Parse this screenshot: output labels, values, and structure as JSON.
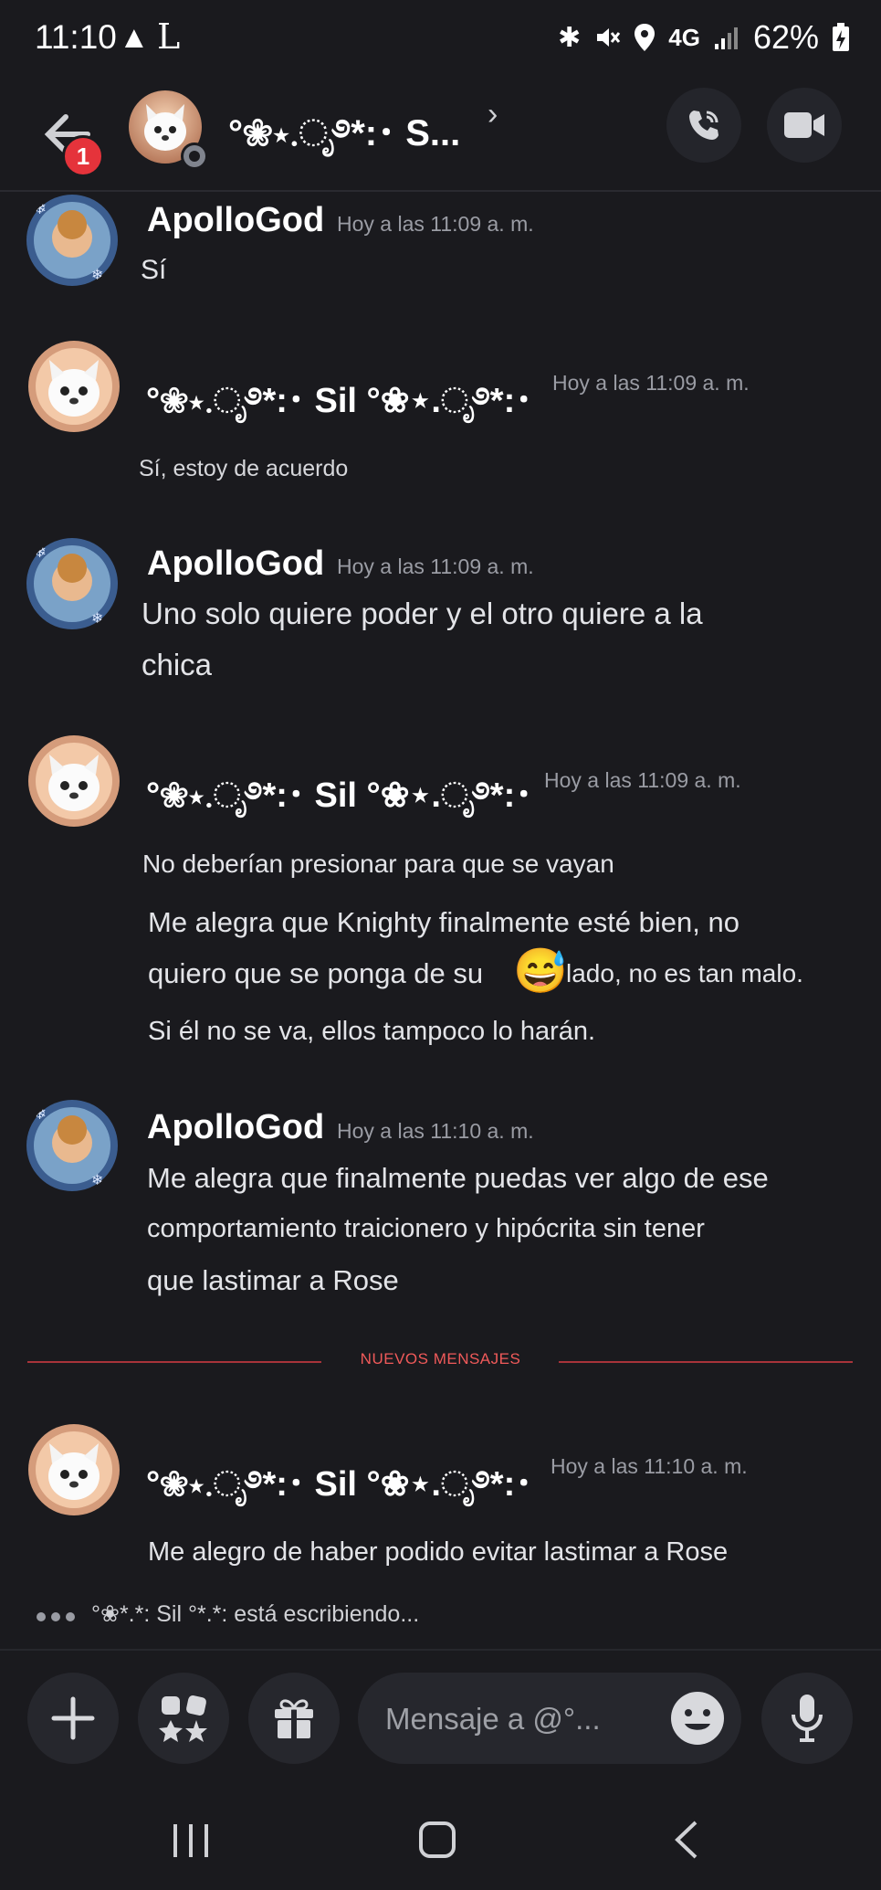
{
  "status_bar": {
    "time": "11:10",
    "network": "4G",
    "battery": "62%"
  },
  "header": {
    "title": "°❀⋆.ೃ࿔*:･ S...",
    "back_badge": "1",
    "chevron": "›"
  },
  "messages": [
    {
      "author": "ApolloGod",
      "time": "Hoy a las 11:09 a. m.",
      "lines": [
        "Sí"
      ]
    },
    {
      "author": "°❀⋆.ೃ࿔*:･ Sil °❀⋆.ೃ࿔*:･",
      "time": "Hoy a las 11:09 a. m.",
      "lines": [
        "Sí, estoy de acuerdo"
      ]
    },
    {
      "author": "ApolloGod",
      "time": "Hoy a las 11:09 a. m.",
      "lines": [
        "Uno solo quiere poder y el otro quiere a la",
        "chica"
      ]
    },
    {
      "author": "°❀⋆.ೃ࿔*:･ Sil °❀⋆.ೃ࿔*:･",
      "time": "Hoy a las 11:09 a. m.",
      "lines": [
        "No deberían presionar para que se vayan",
        "Me alegra que Knighty finalmente esté bien, no",
        "quiero que se ponga de su",
        "lado, no es tan malo.",
        "Si él no se va, ellos tampoco lo harán."
      ],
      "emoji": "😅"
    },
    {
      "author": "ApolloGod",
      "time": "Hoy a las 11:10 a. m.",
      "lines": [
        "Me alegra que finalmente puedas ver algo de ese",
        "comportamiento traicionero y hipócrita sin tener",
        "que lastimar a Rose"
      ]
    },
    {
      "author": "°❀⋆.ೃ࿔*:･ Sil °❀⋆.ೃ࿔*:･",
      "time": "Hoy a las 11:10 a. m.",
      "lines": [
        "Me alegro de haber podido evitar lastimar a Rose"
      ]
    }
  ],
  "divider": {
    "label": "NUEVOS MENSAJES"
  },
  "typing": {
    "text": "°❀*.*: Sil °*.*: está escribiendo..."
  },
  "composer": {
    "placeholder": "Mensaje a @°..."
  },
  "colors": {
    "background": "#1a1a1e",
    "divider": "#a8333a",
    "badge": "#e5333b"
  }
}
